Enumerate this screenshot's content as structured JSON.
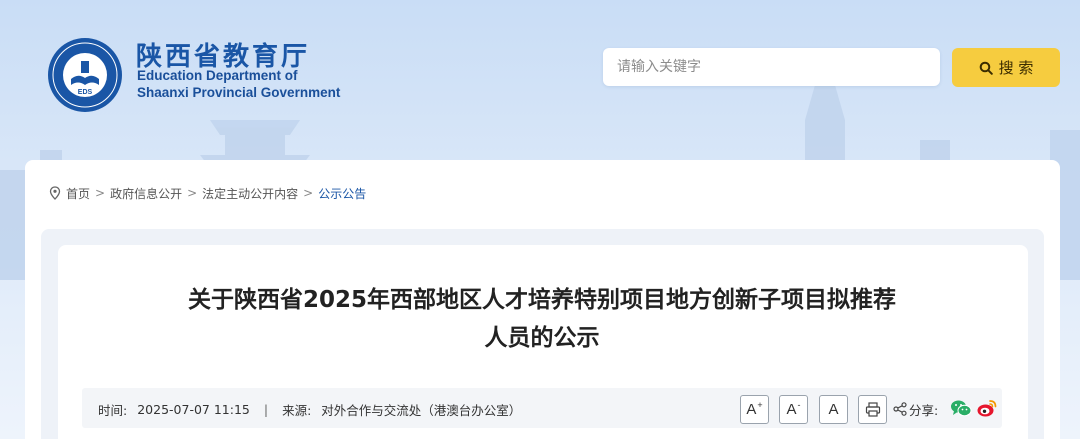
{
  "header": {
    "logo_cn": "陕西省教育厅",
    "logo_en_line1": "Education Department of",
    "logo_en_line2": "Shaanxi Provincial Government",
    "emblem_text": "EDS"
  },
  "search": {
    "placeholder": "请输入关键字",
    "button_label": "搜 索",
    "button_icon": "search-icon"
  },
  "breadcrumb": {
    "icon": "location-pin-icon",
    "items": [
      "首页",
      "政府信息公开",
      "法定主动公开内容",
      "公示公告"
    ],
    "separator": ">"
  },
  "article": {
    "title_line1": "关于陕西省2025年西部地区人才培养特别项目地方创新子项目拟推荐",
    "title_line2": "人员的公示",
    "time_label": "时间:",
    "time_value": "2025-07-07 11:15",
    "divider": "|",
    "source_label": "来源:",
    "source_value": "对外合作与交流处（港澳台办公室）"
  },
  "tools": {
    "font_increase": "A",
    "font_decrease": "A",
    "font_reset": "A",
    "increase_mark": "+",
    "decrease_mark": "-",
    "print_icon": "printer-icon",
    "share_icon": "share-icon",
    "share_label": "分享:",
    "wechat_icon": "wechat-icon",
    "weibo_icon": "weibo-icon"
  },
  "colors": {
    "brand_blue": "#1a56a6",
    "search_button": "#f6cc3f",
    "background": "#c9ddf6"
  }
}
